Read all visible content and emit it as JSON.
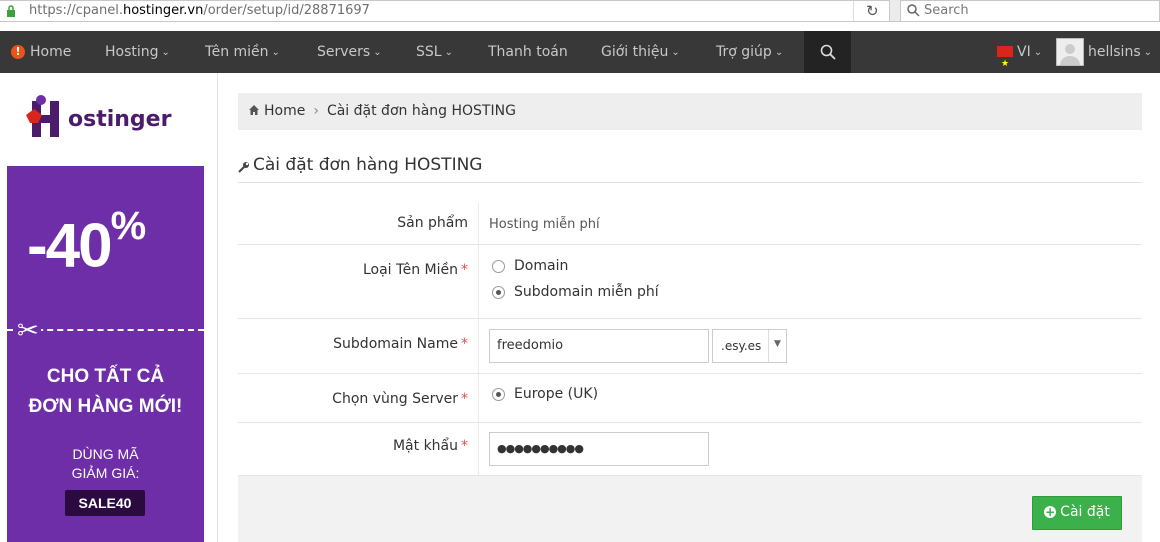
{
  "browser": {
    "url_prefix": "https://cpanel.",
    "url_domain": "hostinger.vn",
    "url_path": "/order/setup/id/28871697",
    "search_placeholder": "Search"
  },
  "nav": {
    "home": "Home",
    "hosting": "Hosting",
    "domain": "Tên miền",
    "servers": "Servers",
    "ssl": "SSL",
    "payment": "Thanh toán",
    "about": "Giới thiệu",
    "help": "Trợ giúp",
    "language": "VI",
    "username": "hellsins"
  },
  "sidebar": {
    "logo_text": "ostinger",
    "promo": {
      "discount": "-40",
      "percent": "%",
      "headline_1": "CHO TẤT CẢ",
      "headline_2": "ĐƠN HÀNG MỚI!",
      "sub_1": "DÙNG MÃ",
      "sub_2": "GIẢM GIÁ:",
      "code": "SALE40",
      "bg_color": "#6d2ea8"
    }
  },
  "breadcrumb": {
    "home": "Home",
    "current": "Cài đặt đơn hàng HOSTING"
  },
  "page": {
    "title": "Cài đặt đơn hàng HOSTING"
  },
  "form": {
    "product_label": "Sản phẩm",
    "product_value": "Hosting miễn phí",
    "domain_type_label": "Loại Tên Miền",
    "domain_type_options": [
      "Domain",
      "Subdomain miễn phí"
    ],
    "domain_type_selected": "Subdomain miễn phí",
    "subdomain_label": "Subdomain Name",
    "subdomain_value": "freedomio",
    "subdomain_suffix": ".esy.es",
    "server_label": "Chọn vùng Server",
    "server_option": "Europe (UK)",
    "password_label": "Mật khẩu",
    "password_mask": "●●●●●●●●●●",
    "required_mark": "*",
    "submit_label": "Cài đặt"
  },
  "colors": {
    "nav_bg": "#383838",
    "accent_green": "#3cb04a",
    "required_red": "#d9534f"
  }
}
